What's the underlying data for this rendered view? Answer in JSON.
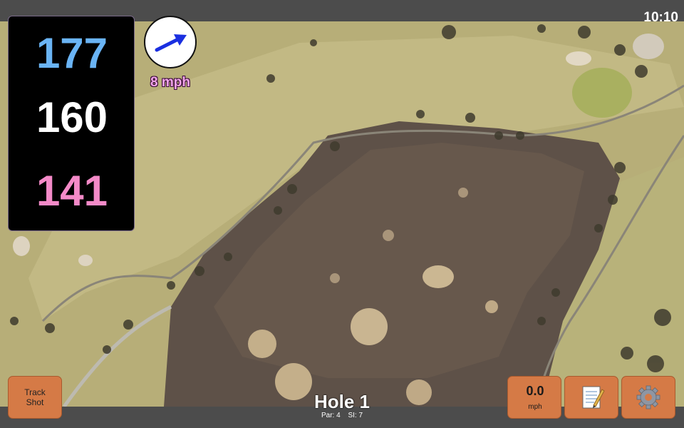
{
  "status_bar": {
    "time": "10:10"
  },
  "distances": {
    "back": "177",
    "middle": "160",
    "front": "141",
    "colors": {
      "back": "#6ab4f5",
      "middle": "#ffffff",
      "front": "#f48ac8"
    }
  },
  "wind": {
    "speed_label": "8 mph",
    "arrow_icon": "wind-direction-arrow-icon",
    "arrow_color": "#1a2fe0"
  },
  "buttons": {
    "track_shot_line1": "Track",
    "track_shot_line2": "Shot",
    "speed_value": "0.0",
    "speed_unit": "mph",
    "notes_icon": "notepad-icon",
    "settings_icon": "gear-icon"
  },
  "hole": {
    "title": "Hole 1",
    "par_label": "Par: 4",
    "si_label": "SI: 7"
  },
  "theme": {
    "button_color": "#d57a46",
    "bar_color": "#4c4c4c"
  }
}
